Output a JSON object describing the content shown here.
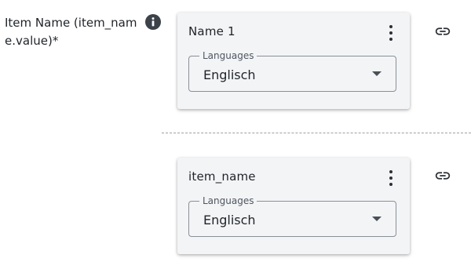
{
  "field": {
    "label": "Item Name (item_name.value)*",
    "info_icon": "info-icon"
  },
  "cards": [
    {
      "title": "Name 1",
      "menu_icon": "more-vertical-icon",
      "select": {
        "legend": "Languages",
        "value": "Englisch",
        "arrow_icon": "dropdown-arrow-icon"
      },
      "link_icon": "link-icon"
    },
    {
      "title": "item_name",
      "menu_icon": "more-vertical-icon",
      "select": {
        "legend": "Languages",
        "value": "Englisch",
        "arrow_icon": "dropdown-arrow-icon"
      },
      "link_icon": "link-icon"
    }
  ],
  "colors": {
    "card_background": "#f3f4f6",
    "icon_dark": "#2b3036",
    "divider": "#9aa0a6"
  }
}
